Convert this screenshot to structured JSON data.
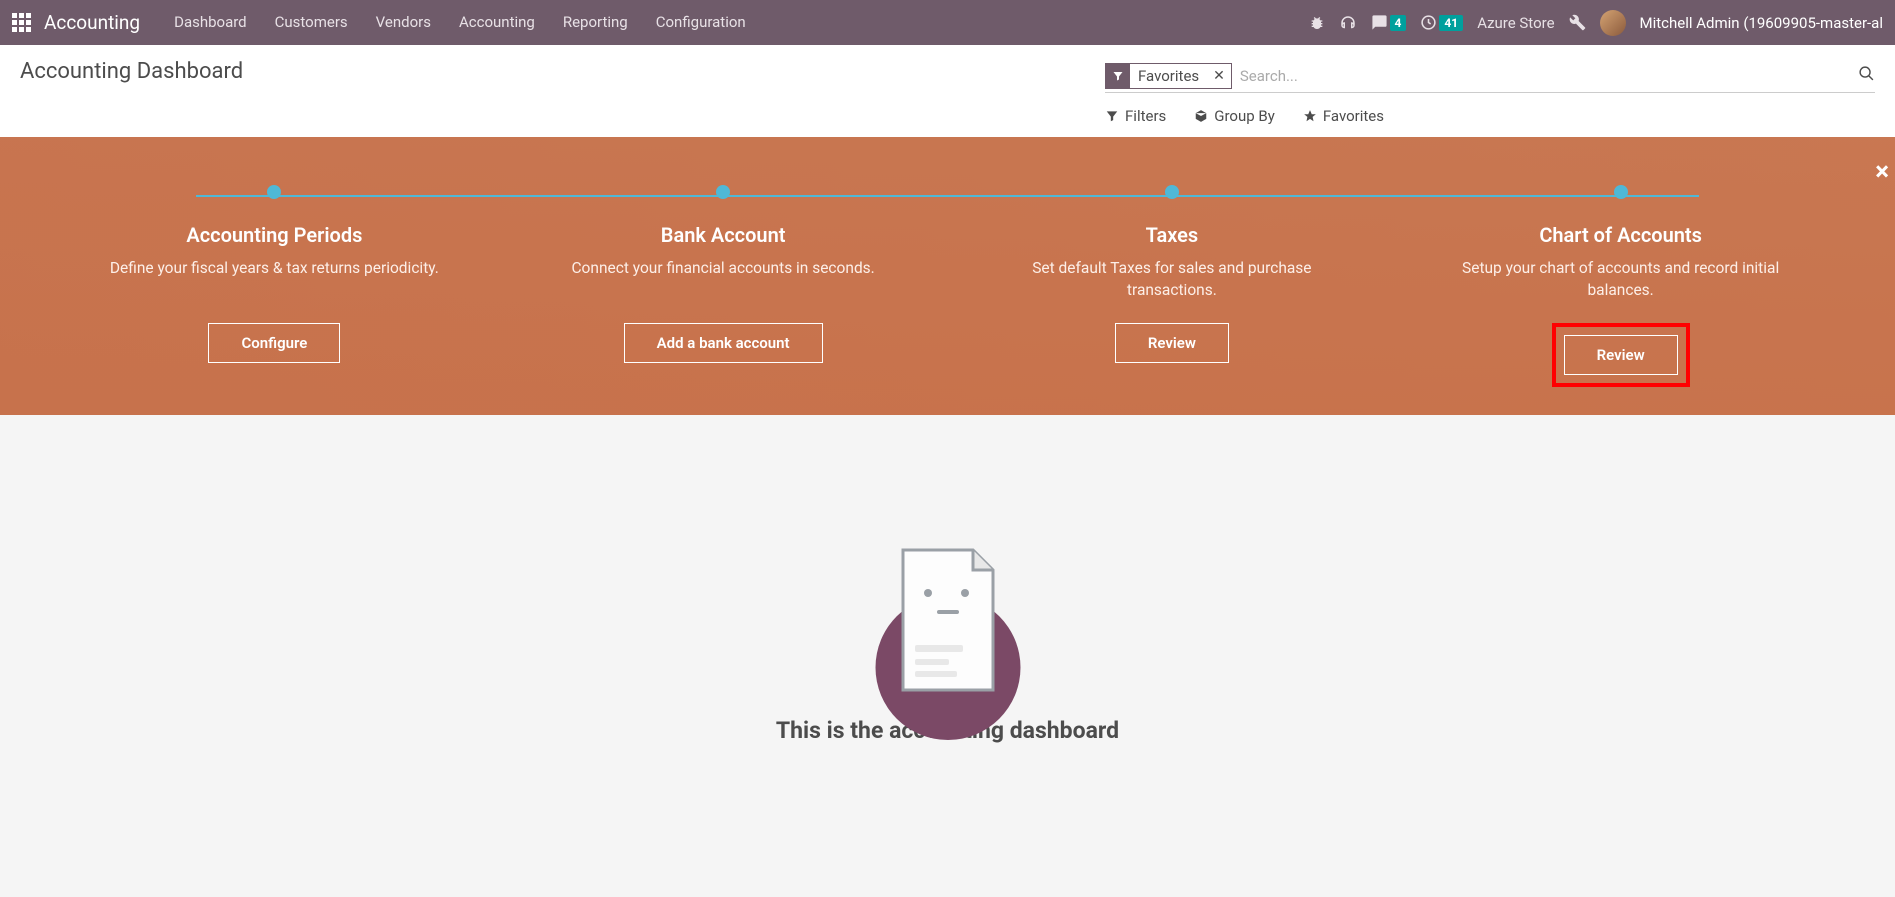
{
  "navbar": {
    "brand": "Accounting",
    "links": [
      "Dashboard",
      "Customers",
      "Vendors",
      "Accounting",
      "Reporting",
      "Configuration"
    ],
    "msg_badge": "4",
    "clock_badge": "41",
    "store": "Azure Store",
    "user": "Mitchell Admin (19609905-master-al"
  },
  "control": {
    "title": "Accounting Dashboard",
    "facet": "Favorites",
    "search_placeholder": "Search...",
    "filters": "Filters",
    "groupby": "Group By",
    "favorites": "Favorites"
  },
  "onboarding": {
    "steps": [
      {
        "title": "Accounting Periods",
        "desc": "Define your fiscal years & tax returns periodicity.",
        "button": "Configure"
      },
      {
        "title": "Bank Account",
        "desc": "Connect your financial accounts in seconds.",
        "button": "Add a bank account"
      },
      {
        "title": "Taxes",
        "desc": "Set default Taxes for sales and purchase transactions.",
        "button": "Review"
      },
      {
        "title": "Chart of Accounts",
        "desc": "Setup your chart of accounts and record initial balances.",
        "button": "Review"
      }
    ]
  },
  "empty": {
    "heading": "This is the accounting dashboard"
  }
}
